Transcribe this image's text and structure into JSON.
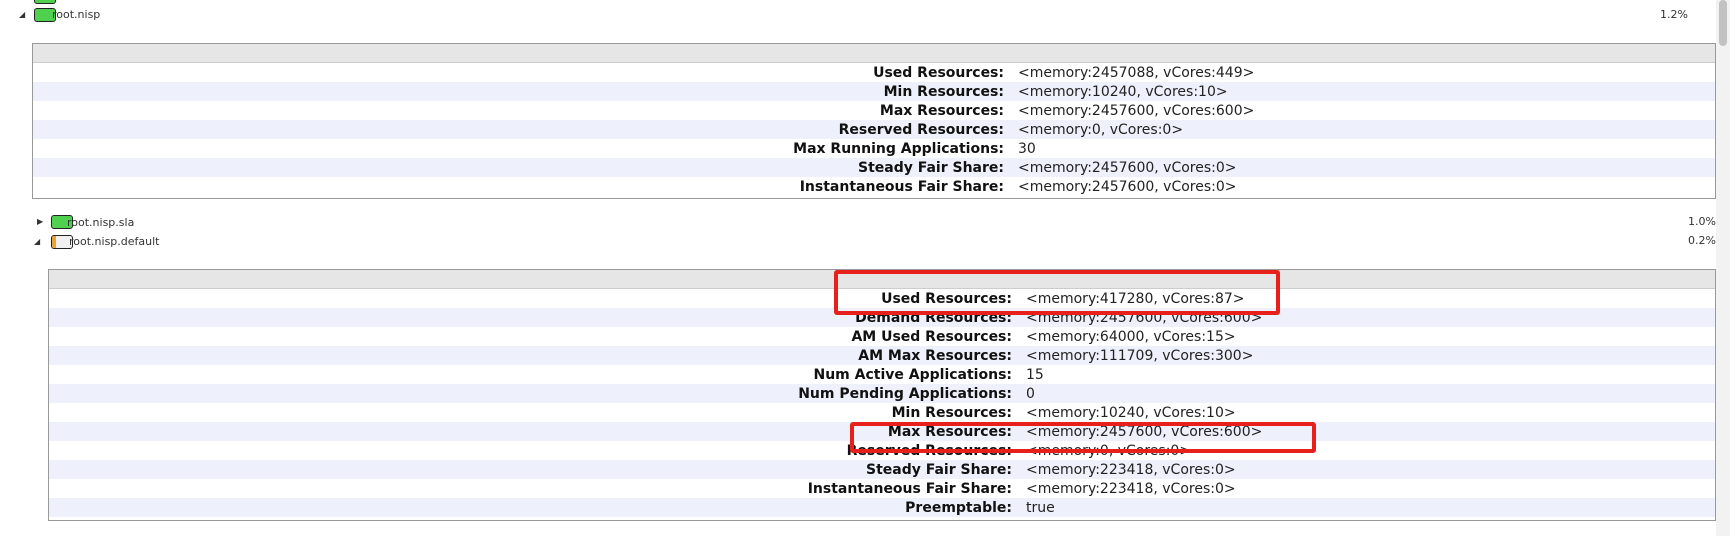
{
  "queues": [
    {
      "name": "root.nisp",
      "percent": "1.2%"
    },
    {
      "name": "root.nisp.sla",
      "percent": "1.0%"
    },
    {
      "name": "root.nisp.default",
      "percent": "0.2%"
    }
  ],
  "panel1": {
    "rows": [
      {
        "label": "Used Resources:",
        "value": "<memory:2457088, vCores:449>"
      },
      {
        "label": "Min Resources:",
        "value": "<memory:10240, vCores:10>"
      },
      {
        "label": "Max Resources:",
        "value": "<memory:2457600, vCores:600>"
      },
      {
        "label": "Reserved Resources:",
        "value": "<memory:0, vCores:0>"
      },
      {
        "label": "Max Running Applications:",
        "value": "30"
      },
      {
        "label": "Steady Fair Share:",
        "value": "<memory:2457600, vCores:0>"
      },
      {
        "label": "Instantaneous Fair Share:",
        "value": "<memory:2457600, vCores:0>"
      }
    ]
  },
  "panel2": {
    "rows": [
      {
        "label": "Used Resources:",
        "value": "<memory:417280, vCores:87>"
      },
      {
        "label": "Demand Resources:",
        "value": "<memory:2457600, vCores:600>"
      },
      {
        "label": "AM Used Resources:",
        "value": "<memory:64000, vCores:15>"
      },
      {
        "label": "AM Max Resources:",
        "value": "<memory:111709, vCores:300>"
      },
      {
        "label": "Num Active Applications:",
        "value": "15"
      },
      {
        "label": "Num Pending Applications:",
        "value": "0"
      },
      {
        "label": "Min Resources:",
        "value": "<memory:10240, vCores:10>"
      },
      {
        "label": "Max Resources:",
        "value": "<memory:2457600, vCores:600>"
      },
      {
        "label": "Reserved Resources:",
        "value": "<memory:0, vCores:0>"
      },
      {
        "label": "Steady Fair Share:",
        "value": "<memory:223418, vCores:0>"
      },
      {
        "label": "Instantaneous Fair Share:",
        "value": "<memory:223418, vCores:0>"
      },
      {
        "label": "Preemptable:",
        "value": "true"
      }
    ]
  },
  "colors": {
    "bar_green": "#4fd14f",
    "bar_orange": "#e8a23a",
    "highlight_red": "#e8201c",
    "stripe": "#eef0fb"
  }
}
